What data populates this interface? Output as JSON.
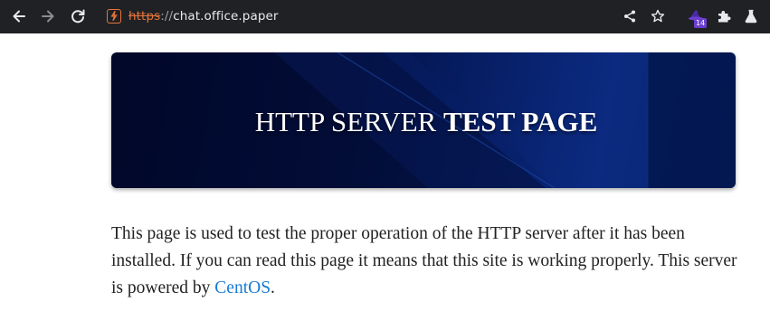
{
  "browser": {
    "url_scheme": "https",
    "url_separator": "://",
    "url_host": "chat.office.paper",
    "extension_badge": "14",
    "icons": {
      "back": "arrow-left-icon",
      "forward": "arrow-right-icon",
      "reload": "reload-icon",
      "site_info": "insecure-site-icon",
      "share": "share-icon",
      "bookmark": "star-icon",
      "extension": "wizard-hat-icon",
      "extensions_menu": "puzzle-icon",
      "labs": "flask-icon"
    },
    "colors": {
      "toolbar": "#202124",
      "insecure": "#e8743b",
      "badge": "#6c3fd1"
    }
  },
  "page": {
    "banner": {
      "title_regular": "HTTP SERVER",
      "title_bold": "TEST PAGE"
    },
    "intro": {
      "text_before_link": "This page is used to test the proper operation of the HTTP server after it has been installed. If you can read this page it means that this site is working properly. This server is powered by ",
      "link_text": "CentOS",
      "text_after_link": "."
    },
    "colors": {
      "link": "#1779d4",
      "banner_dark": "#01092e",
      "banner_light": "#0b2a80"
    }
  }
}
